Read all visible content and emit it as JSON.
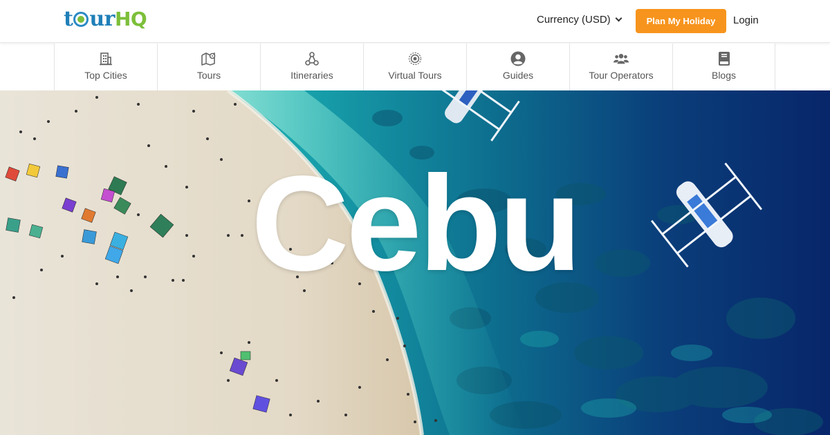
{
  "brand": {
    "logo_text": "tourHQ",
    "logo_part_1": "t",
    "logo_part_2": "ur",
    "logo_part_3": "HQ"
  },
  "header": {
    "currency_label": "Currency (USD)",
    "plan_button": "Plan My Holiday",
    "login_label": "Login"
  },
  "nav": {
    "items": [
      {
        "label": "Top Cities",
        "icon": "building-icon"
      },
      {
        "label": "Tours",
        "icon": "map-pin-icon"
      },
      {
        "label": "Itineraries",
        "icon": "route-icon"
      },
      {
        "label": "Virtual Tours",
        "icon": "virtual-tour-icon"
      },
      {
        "label": "Guides",
        "icon": "user-circle-icon"
      },
      {
        "label": "Tour Operators",
        "icon": "users-group-icon"
      },
      {
        "label": "Blogs",
        "icon": "book-icon"
      }
    ]
  },
  "hero": {
    "title": "Cebu"
  },
  "colors": {
    "accent": "#f7941d",
    "logo_blue": "#1f7fb8",
    "logo_green": "#7cbf3a",
    "nav_text": "#555555"
  }
}
